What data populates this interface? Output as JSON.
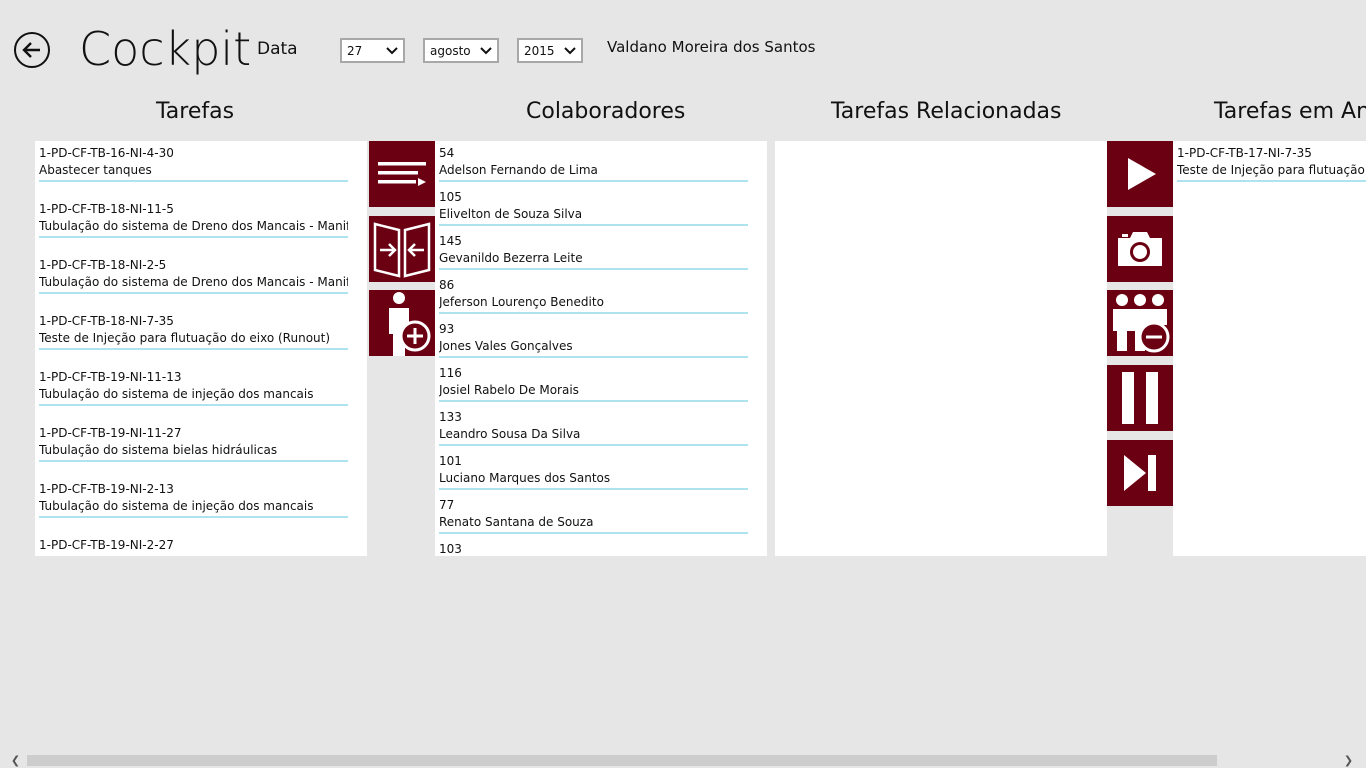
{
  "header": {
    "title": "Cockpit",
    "date_label": "Data",
    "day": "27",
    "month": "agosto",
    "year": "2015",
    "user": "Valdano Moreira dos Santos"
  },
  "columns": {
    "tarefas": "Tarefas",
    "colaboradores": "Colaboradores",
    "relacionadas": "Tarefas Relacionadas",
    "andamento": "Tarefas em And"
  },
  "tarefas": [
    {
      "code": "1-PD-CF-TB-16-NI-4-30",
      "desc": "Abastecer tanques"
    },
    {
      "code": "1-PD-CF-TB-18-NI-11-5",
      "desc": "Tubulação do sistema de Dreno dos Mancais - Manifold a"
    },
    {
      "code": "1-PD-CF-TB-18-NI-2-5",
      "desc": "Tubulação do sistema de Dreno dos Mancais - Manifold a"
    },
    {
      "code": "1-PD-CF-TB-18-NI-7-35",
      "desc": "Teste de Injeção para flutuação do eixo (Runout)"
    },
    {
      "code": "1-PD-CF-TB-19-NI-11-13",
      "desc": "Tubulação do sistema de injeção dos mancais"
    },
    {
      "code": "1-PD-CF-TB-19-NI-11-27",
      "desc": "Tubulação do sistema bielas hidráulicas"
    },
    {
      "code": "1-PD-CF-TB-19-NI-2-13",
      "desc": "Tubulação do sistema de injeção dos mancais"
    },
    {
      "code": "1-PD-CF-TB-19-NI-2-27",
      "desc": ""
    }
  ],
  "colaboradores": [
    {
      "id": "54",
      "name": "Adelson Fernando de Lima"
    },
    {
      "id": "105",
      "name": "Elivelton de Souza Silva"
    },
    {
      "id": "145",
      "name": "Gevanildo Bezerra Leite"
    },
    {
      "id": "86",
      "name": "Jeferson Lourenço Benedito"
    },
    {
      "id": "93",
      "name": "Jones Vales Gonçalves"
    },
    {
      "id": "116",
      "name": "Josiel Rabelo De Morais"
    },
    {
      "id": "133",
      "name": "Leandro Sousa Da Silva"
    },
    {
      "id": "101",
      "name": "Luciano Marques dos Santos"
    },
    {
      "id": "77",
      "name": "Renato Santana de Souza"
    },
    {
      "id": "103",
      "name": ""
    }
  ],
  "andamento": [
    {
      "code": "1-PD-CF-TB-17-NI-7-35",
      "desc": "Teste de Injeção para flutuação do eixo"
    }
  ],
  "tiles_left": [
    "details-icon",
    "merge-icon",
    "add-person-icon"
  ],
  "tiles_right": [
    "play-icon",
    "camera-icon",
    "remove-group-icon",
    "pause-icon",
    "skip-next-icon"
  ],
  "colors": {
    "tile": "#6b0012",
    "divider": "#aee3ef",
    "background": "#e6e6e6"
  }
}
